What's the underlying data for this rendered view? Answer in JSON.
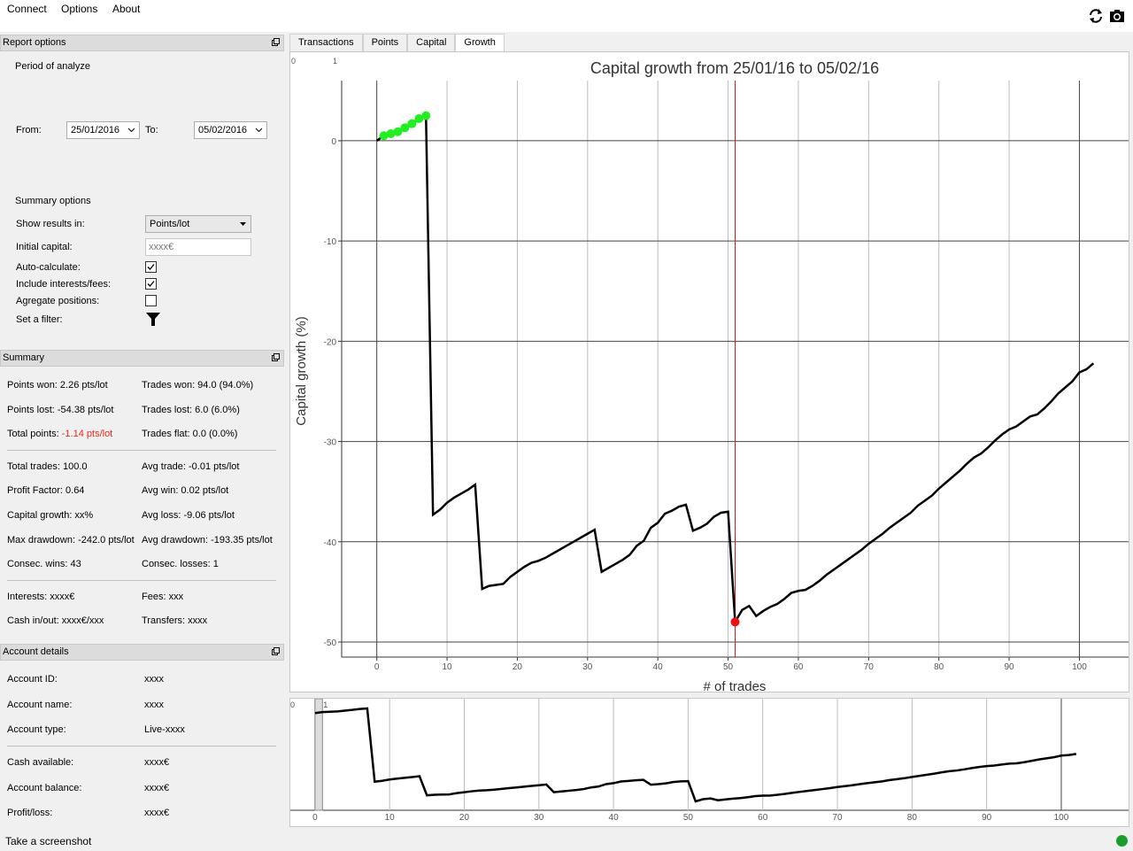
{
  "menu": {
    "connect": "Connect",
    "options": "Options",
    "about": "About"
  },
  "toolbar": {
    "refresh_icon": "refresh-icon",
    "screenshot_icon": "camera-icon"
  },
  "report_options": {
    "title": "Report options",
    "period_label": "Period of analyze",
    "from_label": "From:",
    "from_value": "25/01/2016",
    "to_label": "To:",
    "to_value": "05/02/2016",
    "summary_options_label": "Summary options",
    "show_results_label": "Show results in:",
    "show_results_value": "Points/lot",
    "initial_capital_label": "Initial capital:",
    "initial_capital_placeholder": "xxxx€",
    "auto_calc_label": "Auto-calculate:",
    "auto_calc_checked": true,
    "include_interests_label": "Include interests/fees:",
    "include_interests_checked": true,
    "aggregate_label": "Agregate positions:",
    "aggregate_checked": false,
    "filter_label": "Set a filter:"
  },
  "summary": {
    "title": "Summary",
    "points_won": "Points won: 2.26 pts/lot",
    "trades_won": "Trades won: 94.0 (94.0%)",
    "points_lost": "Points lost: -54.38 pts/lot",
    "trades_lost": "Trades lost: 6.0 (6.0%)",
    "total_points_label": "Total points:",
    "total_points_value": "-1.14 pts/lot",
    "trades_flat": "Trades flat: 0.0 (0.0%)",
    "total_trades": "Total trades: 100.0",
    "avg_trade": "Avg trade: -0.01 pts/lot",
    "profit_factor": "Profit Factor: 0.64",
    "avg_win": "Avg win: 0.02 pts/lot",
    "capital_growth": "Capital growth: xx%",
    "avg_loss": "Avg loss: -9.06 pts/lot",
    "max_drawdown": "Max drawdown: -242.0 pts/lot",
    "avg_drawdown": "Avg drawdown: -193.35 pts/lot",
    "consec_wins": "Consec. wins: 43",
    "consec_losses": "Consec. losses: 1",
    "interests": "Interests: xxxx€",
    "fees": "Fees: xxx",
    "cash_inout": "Cash in/out: xxxx€/xxx",
    "transfers": "Transfers: xxxx"
  },
  "account": {
    "title": "Account details",
    "id_label": "Account ID:",
    "id_value": "xxxx",
    "name_label": "Account name:",
    "name_value": "xxxx",
    "type_label": "Account type:",
    "type_value": "Live-xxxx",
    "cash_label": "Cash available:",
    "cash_value": "xxxx€",
    "balance_label": "Account balance:",
    "balance_value": "xxxx€",
    "pl_label": "Profit/loss:",
    "pl_value": "xxxx€"
  },
  "tabs": [
    "Transactions",
    "Points",
    "Capital",
    "Growth"
  ],
  "active_tab": "Growth",
  "status": {
    "text": "Take a screenshot",
    "led_color": "#1a9d2a"
  },
  "chart_data": {
    "type": "line",
    "title": "Capital growth from 25/01/16 to 05/02/16",
    "xlabel": "# of trades",
    "ylabel": "Capital growth (%)",
    "xlim": [
      -5,
      107
    ],
    "ylim": [
      -51.5,
      6
    ],
    "xticks": [
      0,
      10,
      20,
      30,
      40,
      50,
      60,
      70,
      80,
      90,
      100
    ],
    "yticks": [
      0,
      -10,
      -20,
      -30,
      -40,
      -50
    ],
    "corner_labels": [
      "0",
      "1"
    ],
    "grid": true,
    "line_color": "#000000",
    "win_marker_color": "#22ee22",
    "drawdown_marker_color": "#ee1111",
    "cursor_x": 51,
    "x": [
      0,
      1,
      2,
      3,
      4,
      5,
      6,
      7,
      8,
      9,
      10,
      11,
      12,
      13,
      14,
      15,
      16,
      17,
      18,
      19,
      20,
      21,
      22,
      23,
      24,
      25,
      26,
      27,
      28,
      29,
      30,
      31,
      32,
      33,
      34,
      35,
      36,
      37,
      38,
      39,
      40,
      41,
      42,
      43,
      44,
      45,
      46,
      47,
      48,
      49,
      50,
      51,
      52,
      53,
      54,
      55,
      56,
      57,
      58,
      59,
      60,
      61,
      62,
      63,
      64,
      65,
      66,
      67,
      68,
      69,
      70,
      71,
      72,
      73,
      74,
      75,
      76,
      77,
      78,
      79,
      80,
      81,
      82,
      83,
      84,
      85,
      86,
      87,
      88,
      89,
      90,
      91,
      92,
      93,
      94,
      95,
      96,
      97,
      98,
      99,
      100,
      101,
      102
    ],
    "y": [
      0,
      0.5,
      0.7,
      0.9,
      1.3,
      1.7,
      2.2,
      2.5,
      -37.3,
      -36.8,
      -36.1,
      -35.6,
      -35.2,
      -34.8,
      -34.3,
      -44.7,
      -44.4,
      -44.3,
      -44.2,
      -43.5,
      -43,
      -42.5,
      -42.1,
      -41.9,
      -41.6,
      -41.2,
      -40.8,
      -40.4,
      -40,
      -39.6,
      -39.2,
      -38.8,
      -43,
      -42.6,
      -42.2,
      -41.8,
      -41.3,
      -40.4,
      -39.9,
      -38.6,
      -38.1,
      -37.2,
      -36.9,
      -36.5,
      -36.3,
      -38.9,
      -38.6,
      -38.2,
      -37.5,
      -37.1,
      -37,
      -48,
      -46.8,
      -46.4,
      -47.4,
      -46.9,
      -46.5,
      -46.2,
      -45.7,
      -45.1,
      -44.9,
      -44.8,
      -44.4,
      -43.9,
      -43.3,
      -42.8,
      -42.3,
      -41.8,
      -41.3,
      -40.8,
      -40.2,
      -39.7,
      -39.2,
      -38.6,
      -38.1,
      -37.6,
      -37.1,
      -36.4,
      -35.9,
      -35.4,
      -34.7,
      -34.1,
      -33.5,
      -32.9,
      -32.2,
      -31.6,
      -31.2,
      -30.6,
      -29.9,
      -29.3,
      -28.8,
      -28.5,
      -28,
      -27.5,
      -27.3,
      -26.7,
      -26,
      -25.2,
      -24.6,
      -24,
      -23.1,
      -22.8,
      -22.2
    ]
  },
  "overview_data": {
    "xlim": [
      -2,
      107
    ],
    "xticks": [
      0,
      10,
      20,
      30,
      40,
      50,
      60,
      70,
      80,
      90,
      100
    ],
    "corner_labels": [
      "0",
      "1"
    ]
  }
}
